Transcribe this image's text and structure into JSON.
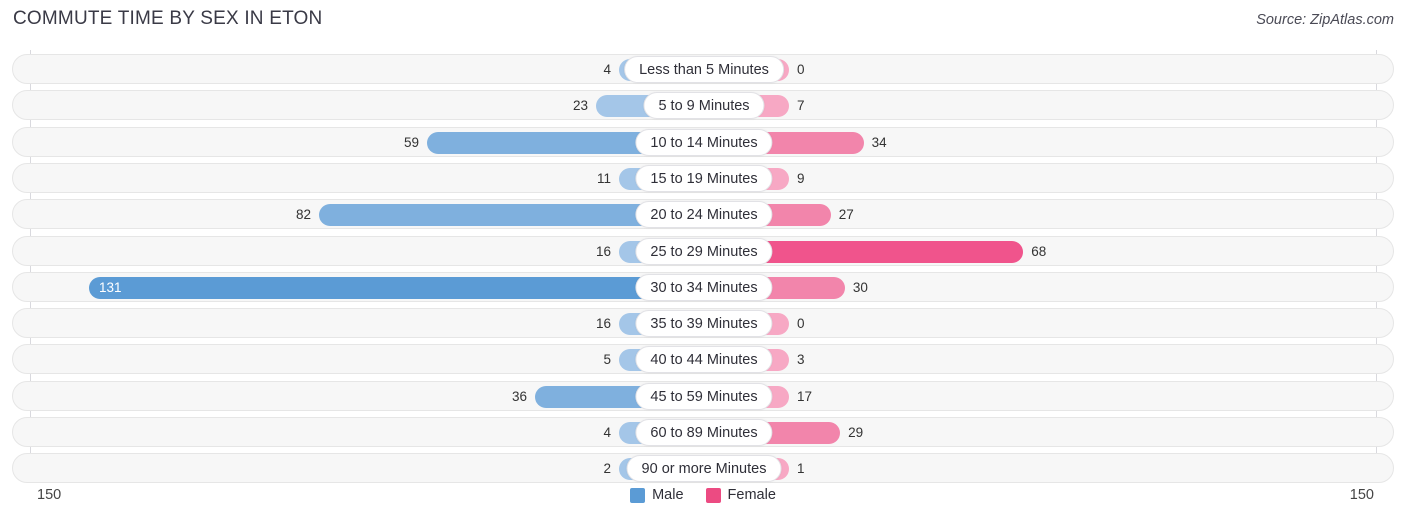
{
  "header": {
    "title": "COMMUTE TIME BY SEX IN ETON",
    "source": "Source: ZipAtlas.com"
  },
  "axis": {
    "left_label": "150",
    "right_label": "150",
    "max": 150
  },
  "legend": {
    "items": [
      {
        "label": "Male",
        "color": "#5b9bd5"
      },
      {
        "label": "Female",
        "color": "#ec4b82"
      }
    ]
  },
  "colors": {
    "male_light": "#a4c6e8",
    "male_mid": "#7fb0de",
    "male_strong": "#5b9bd5",
    "female_light": "#f7a8c4",
    "female_mid": "#f285ab",
    "female_strong": "#f0548c",
    "row_bg": "#f7f7f7",
    "row_border": "#e6e6e6",
    "axis": "#d9d9de",
    "title": "#3a3a46"
  },
  "chart_data": {
    "type": "bar",
    "orientation": "horizontal",
    "layout": "diverging-bidirectional",
    "title": "COMMUTE TIME BY SEX IN ETON",
    "xlabel": "",
    "ylabel": "",
    "xlim": [
      150,
      150
    ],
    "grid": false,
    "legend_position": "bottom-center",
    "categories": [
      "Less than 5 Minutes",
      "5 to 9 Minutes",
      "10 to 14 Minutes",
      "15 to 19 Minutes",
      "20 to 24 Minutes",
      "25 to 29 Minutes",
      "30 to 34 Minutes",
      "35 to 39 Minutes",
      "40 to 44 Minutes",
      "45 to 59 Minutes",
      "60 to 89 Minutes",
      "90 or more Minutes"
    ],
    "series": [
      {
        "name": "Male",
        "side": "left",
        "values": [
          4,
          23,
          59,
          11,
          82,
          16,
          131,
          16,
          5,
          36,
          4,
          2
        ]
      },
      {
        "name": "Female",
        "side": "right",
        "values": [
          0,
          7,
          34,
          9,
          27,
          68,
          30,
          0,
          3,
          17,
          29,
          1
        ]
      }
    ]
  },
  "rows": [
    {
      "category": "Less than 5 Minutes",
      "male": "4",
      "female": "0"
    },
    {
      "category": "5 to 9 Minutes",
      "male": "23",
      "female": "7"
    },
    {
      "category": "10 to 14 Minutes",
      "male": "59",
      "female": "34"
    },
    {
      "category": "15 to 19 Minutes",
      "male": "11",
      "female": "9"
    },
    {
      "category": "20 to 24 Minutes",
      "male": "82",
      "female": "27"
    },
    {
      "category": "25 to 29 Minutes",
      "male": "16",
      "female": "68"
    },
    {
      "category": "30 to 34 Minutes",
      "male": "131",
      "female": "30"
    },
    {
      "category": "35 to 39 Minutes",
      "male": "16",
      "female": "0"
    },
    {
      "category": "40 to 44 Minutes",
      "male": "5",
      "female": "3"
    },
    {
      "category": "45 to 59 Minutes",
      "male": "36",
      "female": "17"
    },
    {
      "category": "60 to 89 Minutes",
      "male": "4",
      "female": "29"
    },
    {
      "category": "90 or more Minutes",
      "male": "2",
      "female": "1"
    }
  ]
}
